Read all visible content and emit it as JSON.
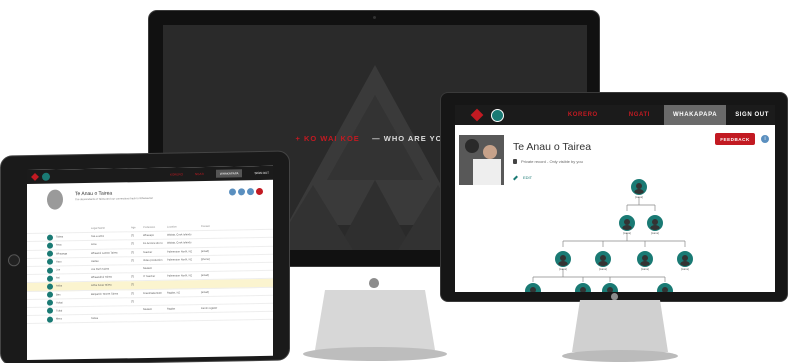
{
  "imac": {
    "tagline_red": "+ KO WAI KOE",
    "tagline_white": "— WHO ARE YOU?"
  },
  "ipad": {
    "nav": [
      "KORERO",
      "NGATI",
      "WHAKAPAPA",
      "SIGN OUT"
    ],
    "profile_title": "Te Anau o Tairea",
    "profile_subtitle": "The descendants of Tairea and our connections back to Whanau/iwi",
    "table_headers": [
      "",
      "Legal Name",
      "Age",
      "Profession",
      "Location",
      "Contact"
    ],
    "rows": [
      {
        "name": "Tairea",
        "legal": "Tae-a-wera",
        "age": "[?]",
        "profession": "Whanapo",
        "location": "Waiata, Cook Islands",
        "contact": ""
      },
      {
        "name": "Aroa",
        "legal": "Aroa",
        "age": "[?]",
        "profession": "Ko Arorere atu tu",
        "location": "Waiata, Cook Islands",
        "contact": ""
      },
      {
        "name": "Whaanga",
        "legal": "Whaanui Lamas Tairea",
        "age": "[?]",
        "profession": "Teacher",
        "location": "Palmerston North, NZ",
        "contact": "[email]"
      },
      {
        "name": "Haro",
        "legal": "Harlee",
        "age": "[?]",
        "profession": "Video production",
        "location": "Palmerston North, NZ",
        "contact": "[phone]"
      },
      {
        "name": "Joe",
        "legal": "Joe Ruth Tairea",
        "age": "",
        "profession": "Student",
        "location": "",
        "contact": ""
      },
      {
        "name": "Ani",
        "legal": "Whaanahui Tairea",
        "age": "[?]",
        "profession": "IT Teacher",
        "location": "Palmerston North, NZ",
        "contact": "[email]"
      },
      {
        "name": "Ariba",
        "legal": "Ariba Kaua Tairea",
        "age": "[?]",
        "profession": "",
        "location": "",
        "contact": ""
      },
      {
        "name": "Ben",
        "legal": "Benjamin Tennet Tairea",
        "age": "[?]",
        "profession": "Grantmakertuter",
        "location": "Raglan, NZ",
        "contact": "[email]"
      },
      {
        "name": "Hokai",
        "legal": "",
        "age": "[?]",
        "profession": "",
        "location": "",
        "contact": ""
      },
      {
        "name": "Tukai",
        "legal": "",
        "age": "",
        "profession": "Student",
        "location": "Raglan",
        "contact": "Kerrin register"
      },
      {
        "name": "Mera",
        "legal": "Tairea",
        "age": "",
        "profession": "",
        "location": "",
        "contact": ""
      }
    ]
  },
  "monitor": {
    "nav": {
      "korero": "KORERO",
      "ngati": "NGATI",
      "whakapapa": "WHAKAPAPA",
      "signout": "SIGN OUT"
    },
    "title": "Te Anau o Tairea",
    "private_note": "Private record - Only visible by you",
    "edit": "EDIT",
    "feedback": "FEEDBACK",
    "info": "i",
    "tree_labels": [
      "[name]",
      "[name]",
      "[name]",
      "[name]",
      "[name]",
      "[name]",
      "[name]",
      "[name]"
    ]
  },
  "colors": {
    "brand_red": "#c21a22",
    "teal": "#1a7a74",
    "dark": "#1b1b1b"
  }
}
